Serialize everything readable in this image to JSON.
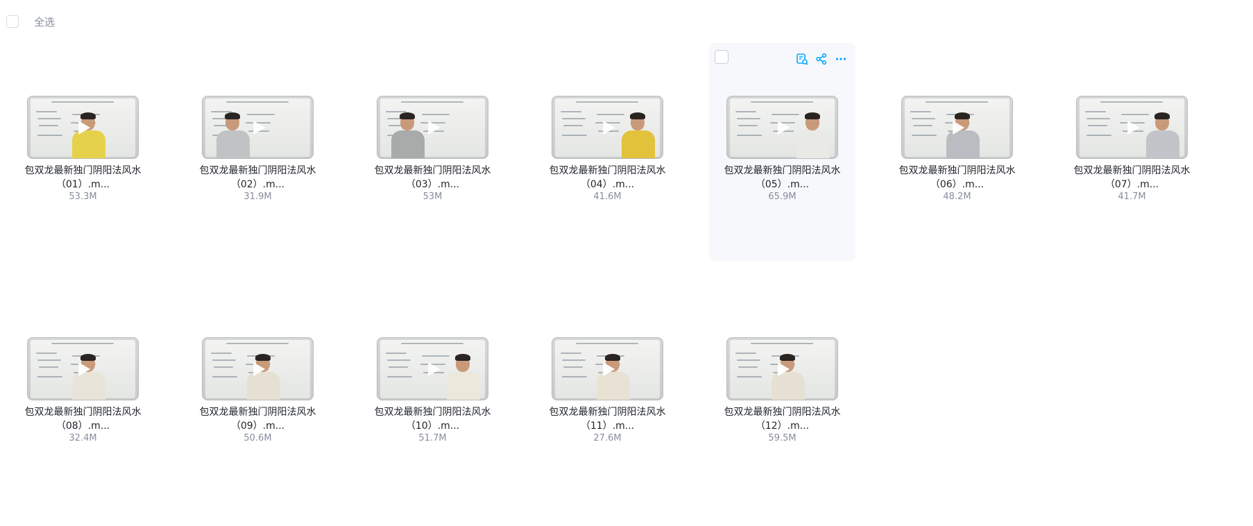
{
  "select_all_label": "全选",
  "colors": {
    "accent": "#06a7ff",
    "hover_bg": "#f7f8fc"
  },
  "hover_actions": [
    "ocr-icon",
    "share-icon",
    "more-icon"
  ],
  "files": [
    {
      "line1": "包双龙最新独门阴阳法风水",
      "line2": "（01）.m...",
      "size": "53.3M",
      "shirt": "#e6d24a",
      "person_side": "center",
      "hovered": false
    },
    {
      "line1": "包双龙最新独门阴阳法风水",
      "line2": "（02）.m...",
      "size": "31.9M",
      "shirt": "#bfc3c4",
      "person_side": "left",
      "hovered": false
    },
    {
      "line1": "包双龙最新独门阴阳法风水",
      "line2": "（03）.m...",
      "size": "53M",
      "shirt": "#a8aba9",
      "person_side": "left",
      "hovered": false
    },
    {
      "line1": "包双龙最新独门阴阳法风水",
      "line2": "（04）.m...",
      "size": "41.6M",
      "shirt": "#e2c23a",
      "person_side": "right",
      "hovered": false
    },
    {
      "line1": "包双龙最新独门阴阳法风水",
      "line2": "（05）.m...",
      "size": "65.9M",
      "shirt": "#e9e9e6",
      "person_side": "right",
      "hovered": true
    },
    {
      "line1": "包双龙最新独门阴阳法风水",
      "line2": "（06）.m...",
      "size": "48.2M",
      "shirt": "#b9bcc0",
      "person_side": "center",
      "hovered": false
    },
    {
      "line1": "包双龙最新独门阴阳法风水",
      "line2": "（07）.m...",
      "size": "41.7M",
      "shirt": "#c1c4c8",
      "person_side": "right",
      "hovered": false
    },
    {
      "line1": "包双龙最新独门阴阳法风水",
      "line2": "（08）.m...",
      "size": "32.4M",
      "shirt": "#e8e4da",
      "person_side": "center",
      "hovered": false
    },
    {
      "line1": "包双龙最新独门阴阳法风水",
      "line2": "（09）.m...",
      "size": "50.6M",
      "shirt": "#e6e0d2",
      "person_side": "center",
      "hovered": false
    },
    {
      "line1": "包双龙最新独门阴阳法风水",
      "line2": "（10）.m...",
      "size": "51.7M",
      "shirt": "#ece8dc",
      "person_side": "right",
      "hovered": false
    },
    {
      "line1": "包双龙最新独门阴阳法风水",
      "line2": "（11）.m...",
      "size": "27.6M",
      "shirt": "#e8e2d4",
      "person_side": "center",
      "hovered": false
    },
    {
      "line1": "包双龙最新独门阴阳法风水",
      "line2": "（12）.m...",
      "size": "59.5M",
      "shirt": "#e6e1d4",
      "person_side": "center",
      "hovered": false
    }
  ]
}
